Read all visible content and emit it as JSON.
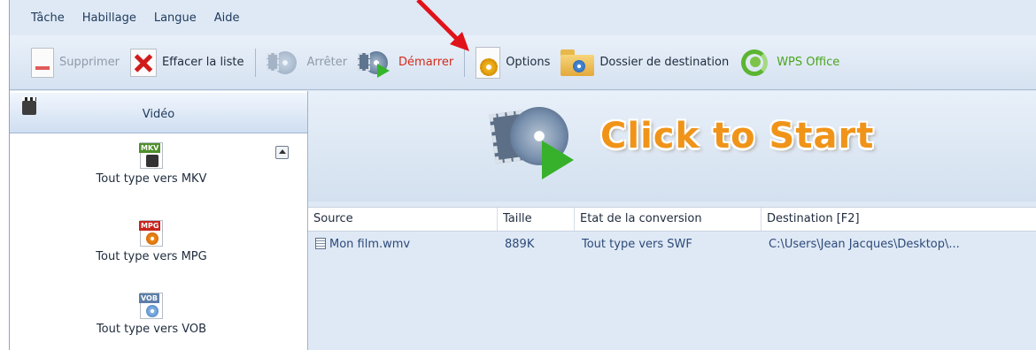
{
  "menu": [
    "Tâche",
    "Habillage",
    "Langue",
    "Aide"
  ],
  "toolbar": {
    "delete": "Supprimer",
    "clear": "Effacer la liste",
    "stop": "Arrêter",
    "start": "Démarrer",
    "options": "Options",
    "destination": "Dossier de destination",
    "wps": "WPS Office"
  },
  "sidebar": {
    "title": "Vidéo",
    "formats": [
      {
        "tag": "MKV",
        "label": "Tout type vers MKV"
      },
      {
        "tag": "MPG",
        "label": "Tout type vers MPG"
      },
      {
        "tag": "VOB",
        "label": "Tout type vers VOB"
      }
    ]
  },
  "banner": {
    "text": "Click to Start"
  },
  "table": {
    "columns": [
      "Source",
      "Taille",
      "Etat de la conversion",
      "Destination [F2]"
    ],
    "rows": [
      {
        "source": "Mon film.wmv",
        "size": "889K",
        "status": "Tout type vers SWF",
        "dest": "C:\\Users\\Jean Jacques\\Desktop\\..."
      }
    ]
  },
  "colors": {
    "accent": "#f09419",
    "active_label": "#d42a1a",
    "wps_green": "#4aa51c",
    "arrow": "#e0131a"
  }
}
